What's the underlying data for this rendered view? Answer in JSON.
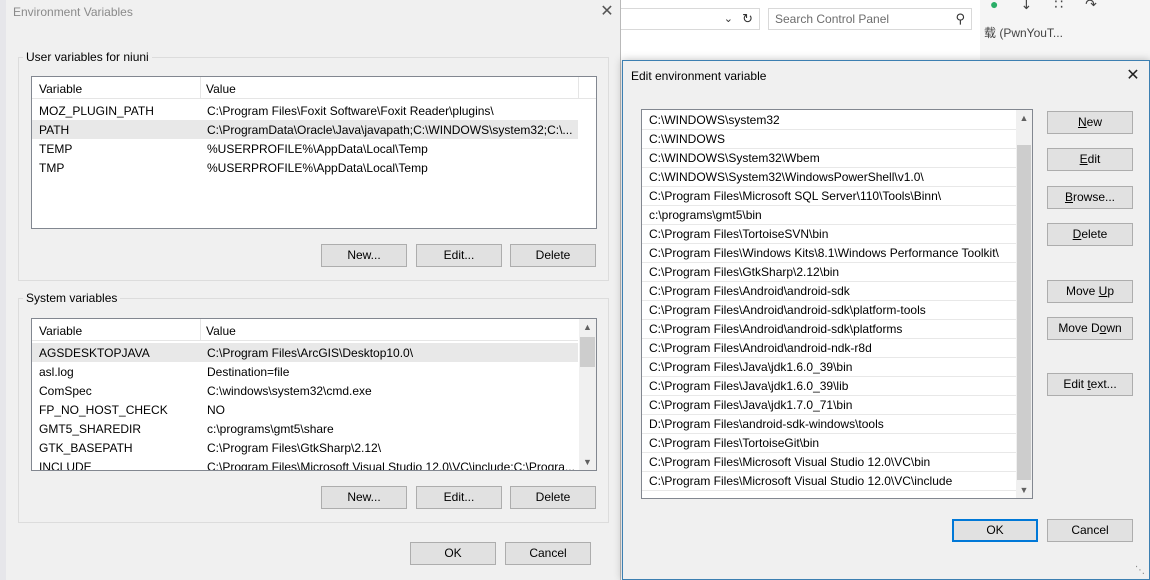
{
  "background": {
    "search_placeholder": "Search Control Panel",
    "right_text": "载 (PwnYouT...",
    "icons": [
      "wechat-icon",
      "download-icon",
      "network-icon",
      "refresh-icon"
    ]
  },
  "env_dialog": {
    "title": "Environment Variables",
    "user_group_label": "User variables for niuni",
    "user_columns": [
      "Variable",
      "Value"
    ],
    "user_rows": [
      {
        "variable": "MOZ_PLUGIN_PATH",
        "value": "C:\\Program Files\\Foxit Software\\Foxit Reader\\plugins\\"
      },
      {
        "variable": "PATH",
        "value": "C:\\ProgramData\\Oracle\\Java\\javapath;C:\\WINDOWS\\system32;C:\\..."
      },
      {
        "variable": "TEMP",
        "value": "%USERPROFILE%\\AppData\\Local\\Temp"
      },
      {
        "variable": "TMP",
        "value": "%USERPROFILE%\\AppData\\Local\\Temp"
      }
    ],
    "user_buttons": {
      "new": "New...",
      "edit": "Edit...",
      "delete": "Delete"
    },
    "system_group_label": "System variables",
    "system_columns": [
      "Variable",
      "Value"
    ],
    "system_rows": [
      {
        "variable": "AGSDESKTOPJAVA",
        "value": "C:\\Program Files\\ArcGIS\\Desktop10.0\\"
      },
      {
        "variable": "asl.log",
        "value": "Destination=file"
      },
      {
        "variable": "ComSpec",
        "value": "C:\\windows\\system32\\cmd.exe"
      },
      {
        "variable": "FP_NO_HOST_CHECK",
        "value": "NO"
      },
      {
        "variable": "GMT5_SHAREDIR",
        "value": "c:\\programs\\gmt5\\share"
      },
      {
        "variable": "GTK_BASEPATH",
        "value": "C:\\Program Files\\GtkSharp\\2.12\\"
      },
      {
        "variable": "INCLUDE",
        "value": "C:\\Program Files\\Microsoft Visual Studio 12.0\\VC\\include;C:\\Progra..."
      }
    ],
    "system_buttons": {
      "new": "New...",
      "edit": "Edit...",
      "delete": "Delete"
    },
    "ok": "OK",
    "cancel": "Cancel"
  },
  "edit_dialog": {
    "title": "Edit environment variable",
    "paths": [
      "C:\\WINDOWS\\system32",
      "C:\\WINDOWS",
      "C:\\WINDOWS\\System32\\Wbem",
      "C:\\WINDOWS\\System32\\WindowsPowerShell\\v1.0\\",
      "C:\\Program Files\\Microsoft SQL Server\\110\\Tools\\Binn\\",
      "c:\\programs\\gmt5\\bin",
      "C:\\Program Files\\TortoiseSVN\\bin",
      "C:\\Program Files\\Windows Kits\\8.1\\Windows Performance Toolkit\\",
      "C:\\Program Files\\GtkSharp\\2.12\\bin",
      "C:\\Program Files\\Android\\android-sdk",
      "C:\\Program Files\\Android\\android-sdk\\platform-tools",
      "C:\\Program Files\\Android\\android-sdk\\platforms",
      "C:\\Program Files\\Android\\android-ndk-r8d",
      "C:\\Program Files\\Java\\jdk1.6.0_39\\bin",
      "C:\\Program Files\\Java\\jdk1.6.0_39\\lib",
      "C:\\Program Files\\Java\\jdk1.7.0_71\\bin",
      "D:\\Program Files\\android-sdk-windows\\tools",
      "C:\\Program Files\\TortoiseGit\\bin",
      "C:\\Program Files\\Microsoft Visual Studio 12.0\\VC\\bin",
      "C:\\Program Files\\Microsoft Visual Studio 12.0\\VC\\include"
    ],
    "buttons": {
      "new_u": "N",
      "new_rest": "ew",
      "edit_u": "E",
      "edit_rest": "dit",
      "browse_u": "B",
      "browse_rest": "rowse...",
      "delete_u": "D",
      "delete_rest": "elete",
      "move_up_pre": "Move ",
      "move_up_u": "U",
      "move_up_rest": "p",
      "move_down_pre": "Move D",
      "move_down_u": "o",
      "move_down_rest": "wn",
      "edit_text_pre": "Edit ",
      "edit_text_u": "t",
      "edit_text_rest": "ext..."
    },
    "ok": "OK",
    "cancel": "Cancel"
  }
}
